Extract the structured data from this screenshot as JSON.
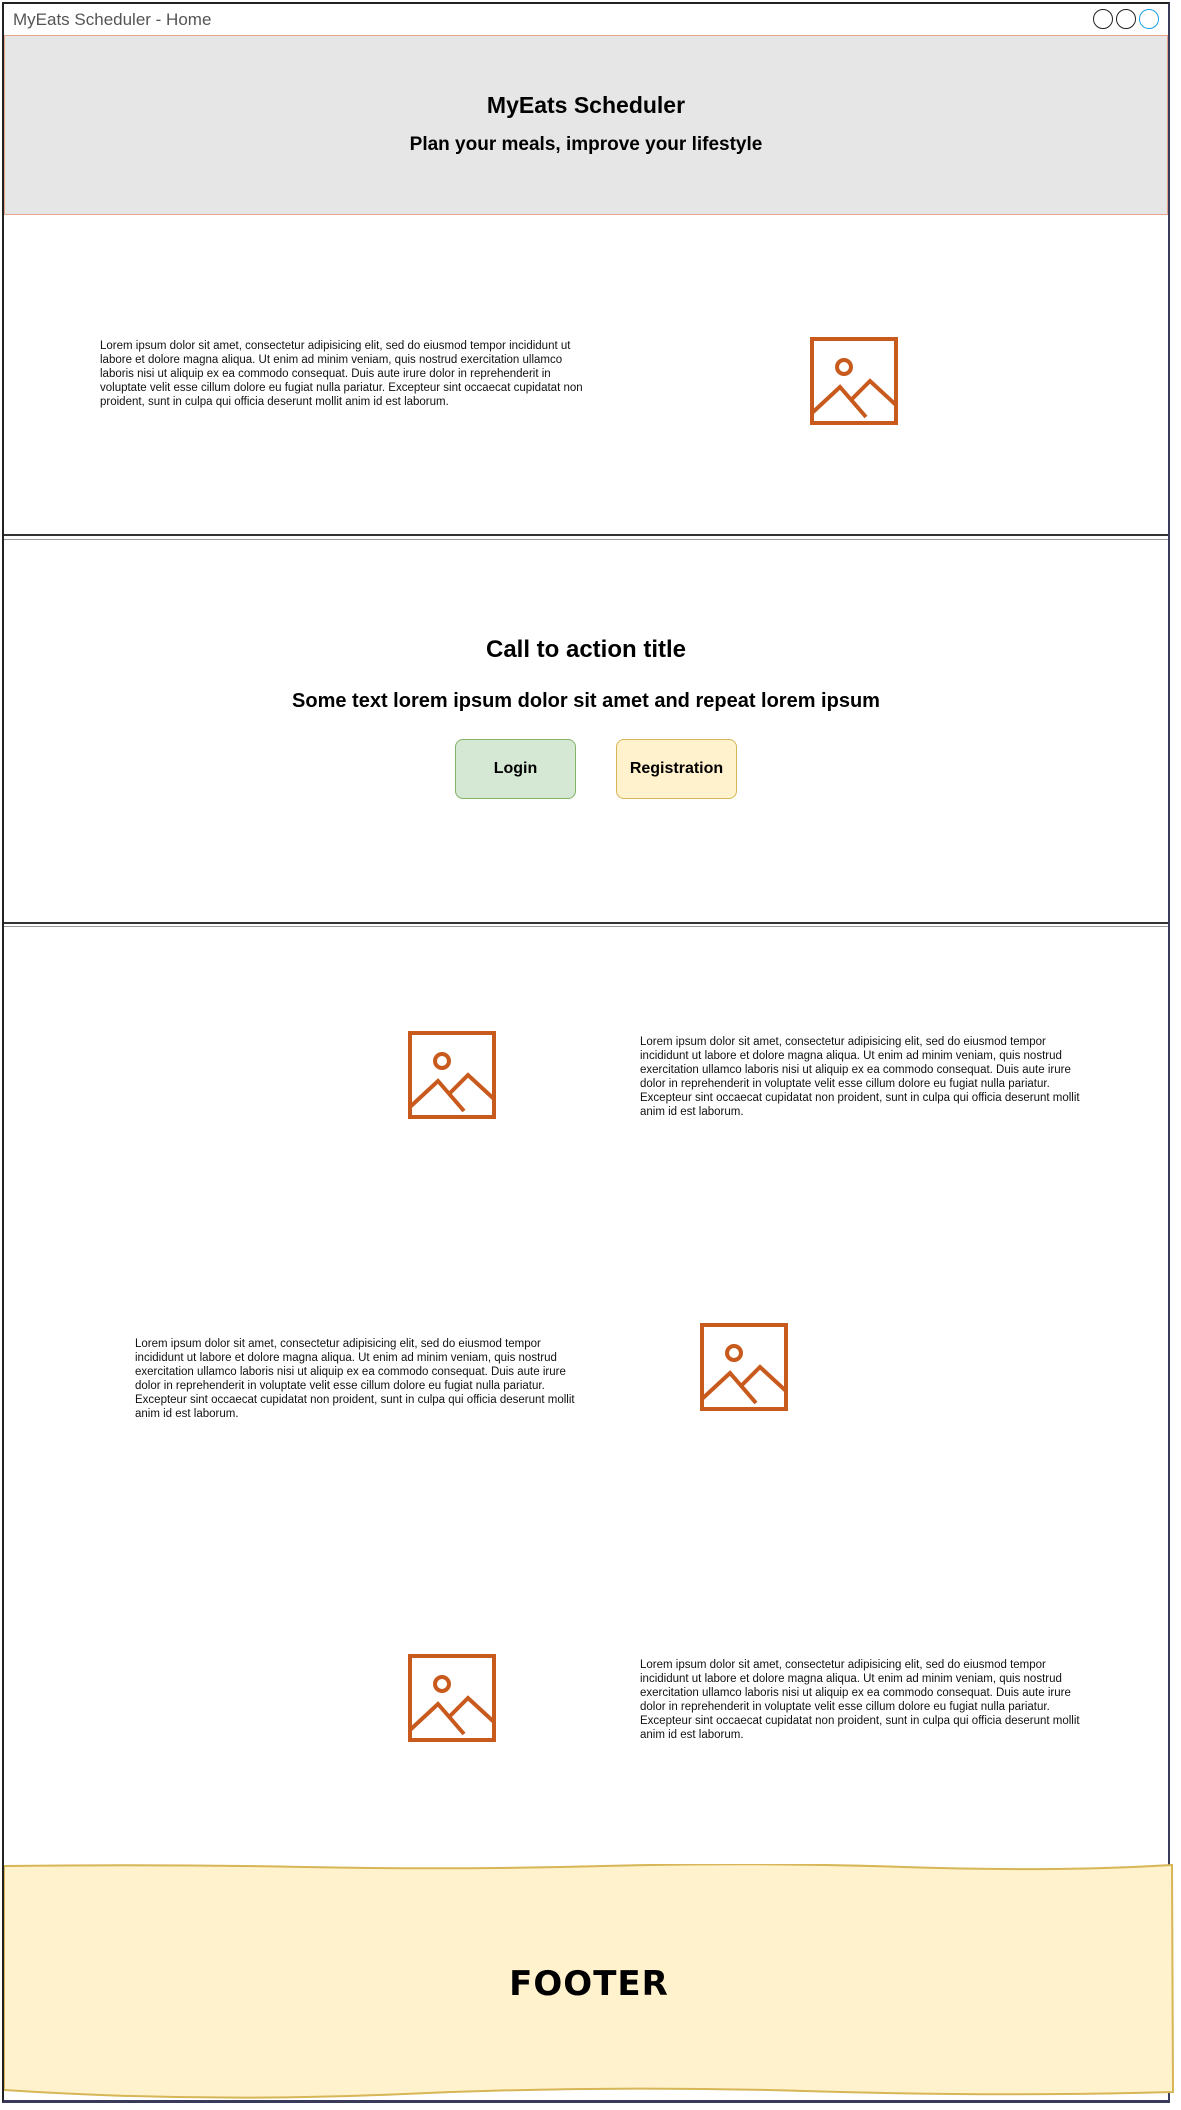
{
  "window": {
    "title": "MyEats Scheduler - Home"
  },
  "header": {
    "title": "MyEats Scheduler",
    "subtitle": "Plan your meals, improve your lifestyle"
  },
  "lorem": "Lorem ipsum dolor sit amet, consectetur adipisicing elit, sed do eiusmod tempor incididunt ut labore et dolore magna aliqua. Ut enim ad minim veniam, quis nostrud exercitation ullamco laboris nisi ut aliquip ex ea commodo consequat. Duis aute irure dolor in reprehenderit in voluptate velit esse cillum dolore eu fugiat nulla pariatur. Excepteur sint occaecat cupidatat non proident, sunt in culpa qui officia deserunt mollit anim id est laborum.",
  "intro": {
    "text": "Lorem ipsum dolor sit amet, consectetur adipisicing elit, sed do eiusmod tempor incididunt ut labore et dolore magna aliqua. Ut enim ad minim veniam, quis nostrud exercitation ullamco laboris nisi ut aliquip ex ea commodo consequat. Duis aute irure dolor in reprehenderit in voluptate velit esse cillum dolore eu fugiat nulla pariatur. Excepteur sint occaecat cupidatat non proident, sunt in culpa qui officia deserunt mollit anim id est laborum.",
    "image_icon": "image-placeholder-icon"
  },
  "cta": {
    "title": "Call to action title",
    "subtitle": "Some text lorem ipsum dolor sit amet and repeat lorem ipsum",
    "login_label": "Login",
    "registration_label": "Registration"
  },
  "features": [
    {
      "text": "Lorem ipsum dolor sit amet, consectetur adipisicing elit, sed do eiusmod tempor incididunt ut labore et dolore magna aliqua. Ut enim ad minim veniam, quis nostrud exercitation ullamco laboris nisi ut aliquip ex ea commodo consequat. Duis aute irure dolor in reprehenderit in voluptate velit esse cillum dolore eu fugiat nulla pariatur. Excepteur sint occaecat cupidatat non proident, sunt in culpa qui officia deserunt mollit anim id est laborum."
    },
    {
      "text": "Lorem ipsum dolor sit amet, consectetur adipisicing elit, sed do eiusmod tempor incididunt ut labore et dolore magna aliqua. Ut enim ad minim veniam, quis nostrud exercitation ullamco laboris nisi ut aliquip ex ea commodo consequat. Duis aute irure dolor in reprehenderit in voluptate velit esse cillum dolore eu fugiat nulla pariatur. Excepteur sint occaecat cupidatat non proident, sunt in culpa qui officia deserunt mollit anim id est laborum."
    },
    {
      "text": "Lorem ipsum dolor sit amet, consectetur adipisicing elit, sed do eiusmod tempor incididunt ut labore et dolore magna aliqua. Ut enim ad minim veniam, quis nostrud exercitation ullamco laboris nisi ut aliquip ex ea commodo consequat. Duis aute irure dolor in reprehenderit in voluptate velit esse cillum dolore eu fugiat nulla pariatur. Excepteur sint occaecat cupidatat non proident, sunt in culpa qui officia deserunt mollit anim id est laborum."
    }
  ],
  "footer": {
    "label": "FOOTER"
  },
  "colors": {
    "header_bg": "#e6e6e6",
    "image_stroke": "#c85a1e",
    "login_bg": "#d5e8d4",
    "registration_bg": "#fff2cc",
    "footer_bg": "#fff2cc"
  }
}
